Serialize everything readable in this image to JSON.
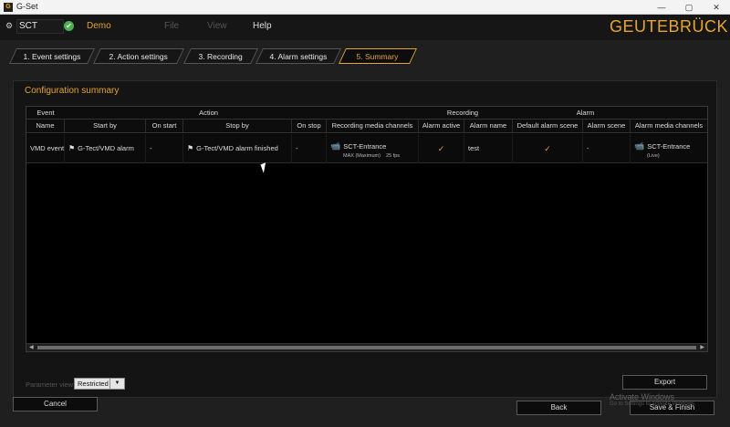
{
  "window": {
    "title": "G-Set",
    "icon": "G",
    "minimize": "—",
    "maximize": "▢",
    "close": "✕"
  },
  "topbar": {
    "server_icon": "⚙",
    "server_name": "SCT",
    "status_icon": "✔",
    "profile": "Demo",
    "menu": [
      "File",
      "View",
      "Help"
    ],
    "logo": "GEUTEBRÜCK"
  },
  "tabs": [
    "1. Event settings",
    "2. Action settings",
    "3. Recording",
    "4. Alarm settings",
    "5. Summary"
  ],
  "panel": {
    "title": "Configuration summary",
    "groups": [
      "Event",
      "Action",
      "Recording",
      "Alarm"
    ],
    "columns": [
      "Name",
      "Start by",
      "On start",
      "Stop by",
      "On stop",
      "Recording media channels",
      "Alarm active",
      "Alarm name",
      "Default alarm scene",
      "Alarm scene",
      "Alarm media channels"
    ],
    "row": {
      "name": "VMD event",
      "start_by": "G-Tect/VMD alarm",
      "on_start": "-",
      "stop_by": "G-Tect/VMD alarm finished",
      "on_stop": "-",
      "rec_channel": "SCT-Entrance",
      "rec_quality": "MAX (Maximum)",
      "rec_fps": "25 fps",
      "alarm_active": "✓",
      "alarm_name": "test",
      "default_scene": "✓",
      "alarm_scene": "-",
      "alarm_channel": "SCT-Entrance",
      "alarm_channel_mode": "(Live)"
    },
    "param_label": "Parameter view:",
    "param_value": "Restricted",
    "export_label": "Export"
  },
  "footer": {
    "cancel_label": "Cancel",
    "back_label": "Back",
    "save_label": "Save & Finish",
    "activate_title": "Activate Windows",
    "activate_sub": "Go to Settings to activate Windows."
  },
  "colors": {
    "accent": "#e6a431",
    "status_ok": "#4caf50"
  }
}
